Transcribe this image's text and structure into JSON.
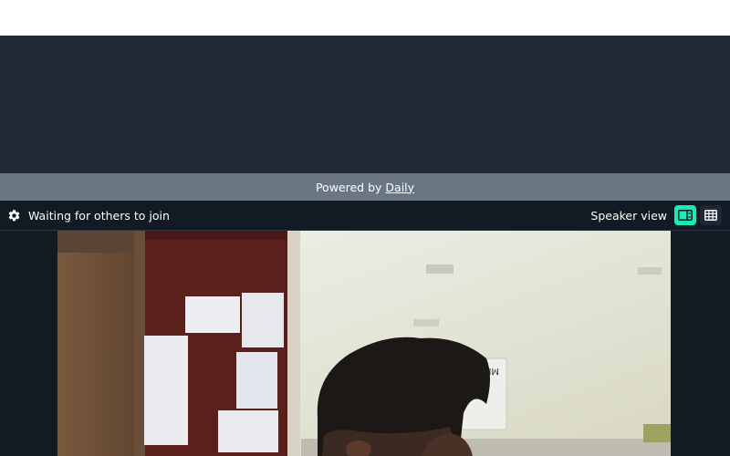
{
  "footer": {
    "powered_prefix": "Powered by",
    "powered_link": "Daily"
  },
  "call_bar": {
    "settings_icon": "gear-icon",
    "status": "Waiting for others to join",
    "view_label": "Speaker view",
    "speaker_view_icon": "speaker-view-icon",
    "grid_view_icon": "grid-view-icon",
    "active_view": "speaker"
  },
  "colors": {
    "dark_panel": "#222a38",
    "powered_bar": "#6b7683",
    "call_bar": "#121a24",
    "accent": "#1bebb9"
  }
}
